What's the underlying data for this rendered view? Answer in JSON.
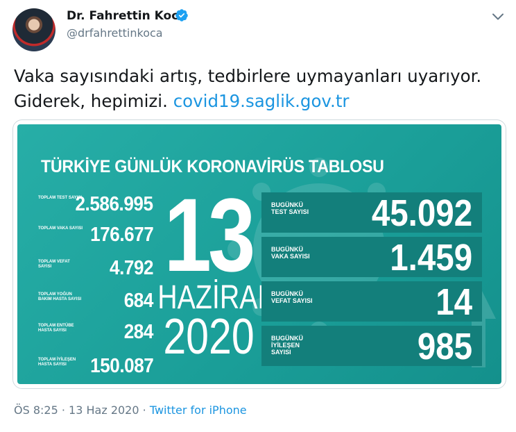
{
  "author": {
    "name": "Dr. Fahrettin Koca",
    "handle": "@drfahrettinkoca"
  },
  "tweet": {
    "text_line1": "Vaka sayısındaki artış, tedbirlere uymayanları uyarıyor.",
    "text_line2": "Giderek, hepimizi.",
    "link": "covid19.saglik.gov.tr"
  },
  "card": {
    "heading": "TÜRKİYE GÜNLÜK KORONAVİRÜS TABLOSU",
    "totals": [
      {
        "label": "TOPLAM TEST SAYISI",
        "value": "2.586.995"
      },
      {
        "label": "TOPLAM VAKA SAYISI",
        "value": "176.677"
      },
      {
        "label": "TOPLAM VEFAT SAYISI",
        "value": "4.792"
      },
      {
        "label": "TOPLAM YOĞUN BAKIM HASTA SAYISI",
        "value": "684"
      },
      {
        "label": "TOPLAM ENTÜBE HASTA SAYISI",
        "value": "284"
      },
      {
        "label": "TOPLAM İYİLEŞEN HASTA SAYISI",
        "value": "150.087"
      }
    ],
    "date": {
      "day": "13",
      "month": "HAZİRAN",
      "year": "2020"
    },
    "today": [
      {
        "label": "BUGÜNKÜ TEST SAYISI",
        "value": "45.092"
      },
      {
        "label": "BUGÜNKÜ VAKA SAYISI",
        "value": "1.459"
      },
      {
        "label": "BUGÜNKÜ VEFAT SAYISI",
        "value": "14"
      },
      {
        "label": "BUGÜNKÜ İYİLEŞEN SAYISI",
        "value": "985"
      }
    ]
  },
  "meta": {
    "time": "ÖS 8:25",
    "date": "13 Haz 2020",
    "separator": "·",
    "source": "Twitter for iPhone"
  },
  "icons": {
    "verified": "verified-badge-icon",
    "menu": "chevron-down-icon"
  },
  "colors": {
    "accent": "#1b95e0",
    "card_bg": "#1a9e98",
    "card_box": "#137f7b"
  }
}
